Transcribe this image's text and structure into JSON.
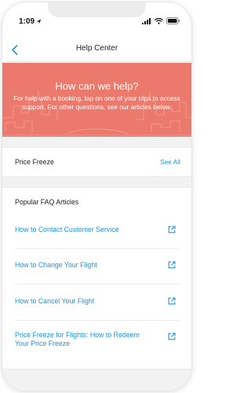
{
  "status_bar": {
    "time": "1:09",
    "icons": [
      "location-arrow-icon",
      "cellular-signal-icon",
      "wifi-icon",
      "battery-icon"
    ]
  },
  "nav": {
    "title": "Help Center",
    "back_icon": "chevron-left-icon"
  },
  "hero": {
    "title": "How can we help?",
    "body": "For help with a booking, tap on one of your trips to access support. For other questions, see our articles below."
  },
  "price_freeze": {
    "title": "Price Freeze",
    "action": "See All"
  },
  "faq": {
    "heading": "Popular FAQ Articles",
    "items": [
      {
        "label": "How to Contact Customer Service",
        "icon": "external-link-icon"
      },
      {
        "label": "How to Change Your Flight",
        "icon": "external-link-icon"
      },
      {
        "label": "How to Cancel Your Flight",
        "icon": "external-link-icon"
      },
      {
        "label": "Price Freeze for Flights: How to Redeem Your Price Freeze",
        "icon": "external-link-icon"
      }
    ]
  },
  "colors": {
    "accent": "#1d93d8",
    "hero_background": "#ec7a6c",
    "section_background": "#f2f2f2"
  }
}
